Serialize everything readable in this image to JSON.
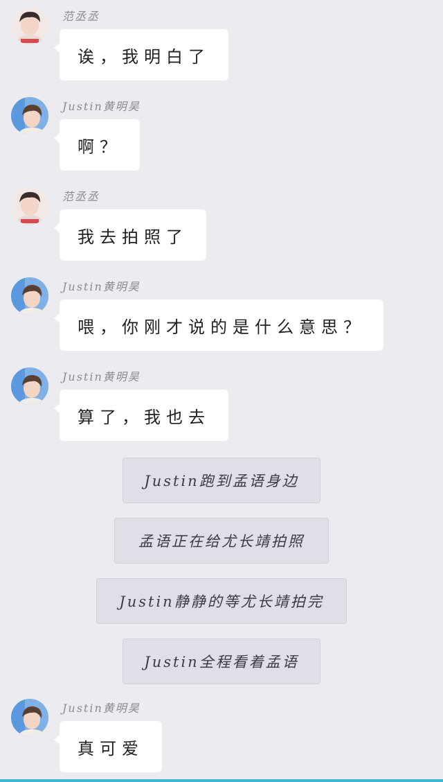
{
  "messages": [
    {
      "sender": "范丞丞",
      "avatar": "fan-avatar",
      "text": "诶，我明白了"
    },
    {
      "sender": "Justin黄明昊",
      "avatar": "justin-avatar",
      "text": "啊？"
    },
    {
      "sender": "范丞丞",
      "avatar": "fan-avatar",
      "text": "我去拍照了"
    },
    {
      "sender": "Justin黄明昊",
      "avatar": "justin-avatar",
      "text": "喂，你刚才说的是什么意思？"
    },
    {
      "sender": "Justin黄明昊",
      "avatar": "justin-avatar",
      "text": "算了，我也去"
    },
    {
      "sender": "Justin黄明昊",
      "avatar": "justin-avatar",
      "text": "真可爱"
    }
  ],
  "narration": [
    "Justin跑到孟语身边",
    "孟语正在给尤长靖拍照",
    "Justin静静的等尤长靖拍完",
    "Justin全程看着孟语"
  ],
  "colors": {
    "background": "#ebebf0",
    "bubble": "#ffffff",
    "narration_box": "#dfe0e7",
    "bottom_bar": "#3fb6d4"
  }
}
